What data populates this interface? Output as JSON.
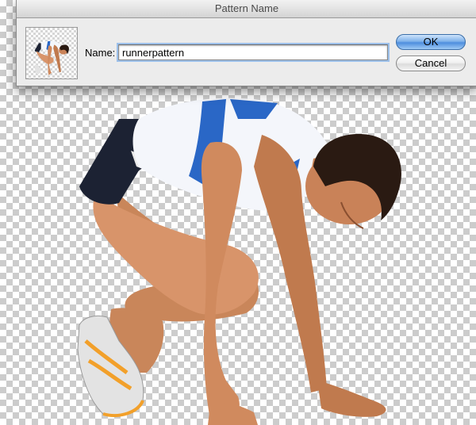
{
  "window": {
    "title": "Pattern Name"
  },
  "form": {
    "name_label": "Name:",
    "name_value": "runnerpattern"
  },
  "buttons": {
    "ok_label": "OK",
    "cancel_label": "Cancel"
  },
  "colors": {
    "accent": "#4e8ede",
    "dialog_bg": "#ececec",
    "checker_dark": "#cccccc",
    "checker_light": "#ffffff"
  },
  "icons": {
    "preview": "pattern-preview-thumbnail"
  }
}
